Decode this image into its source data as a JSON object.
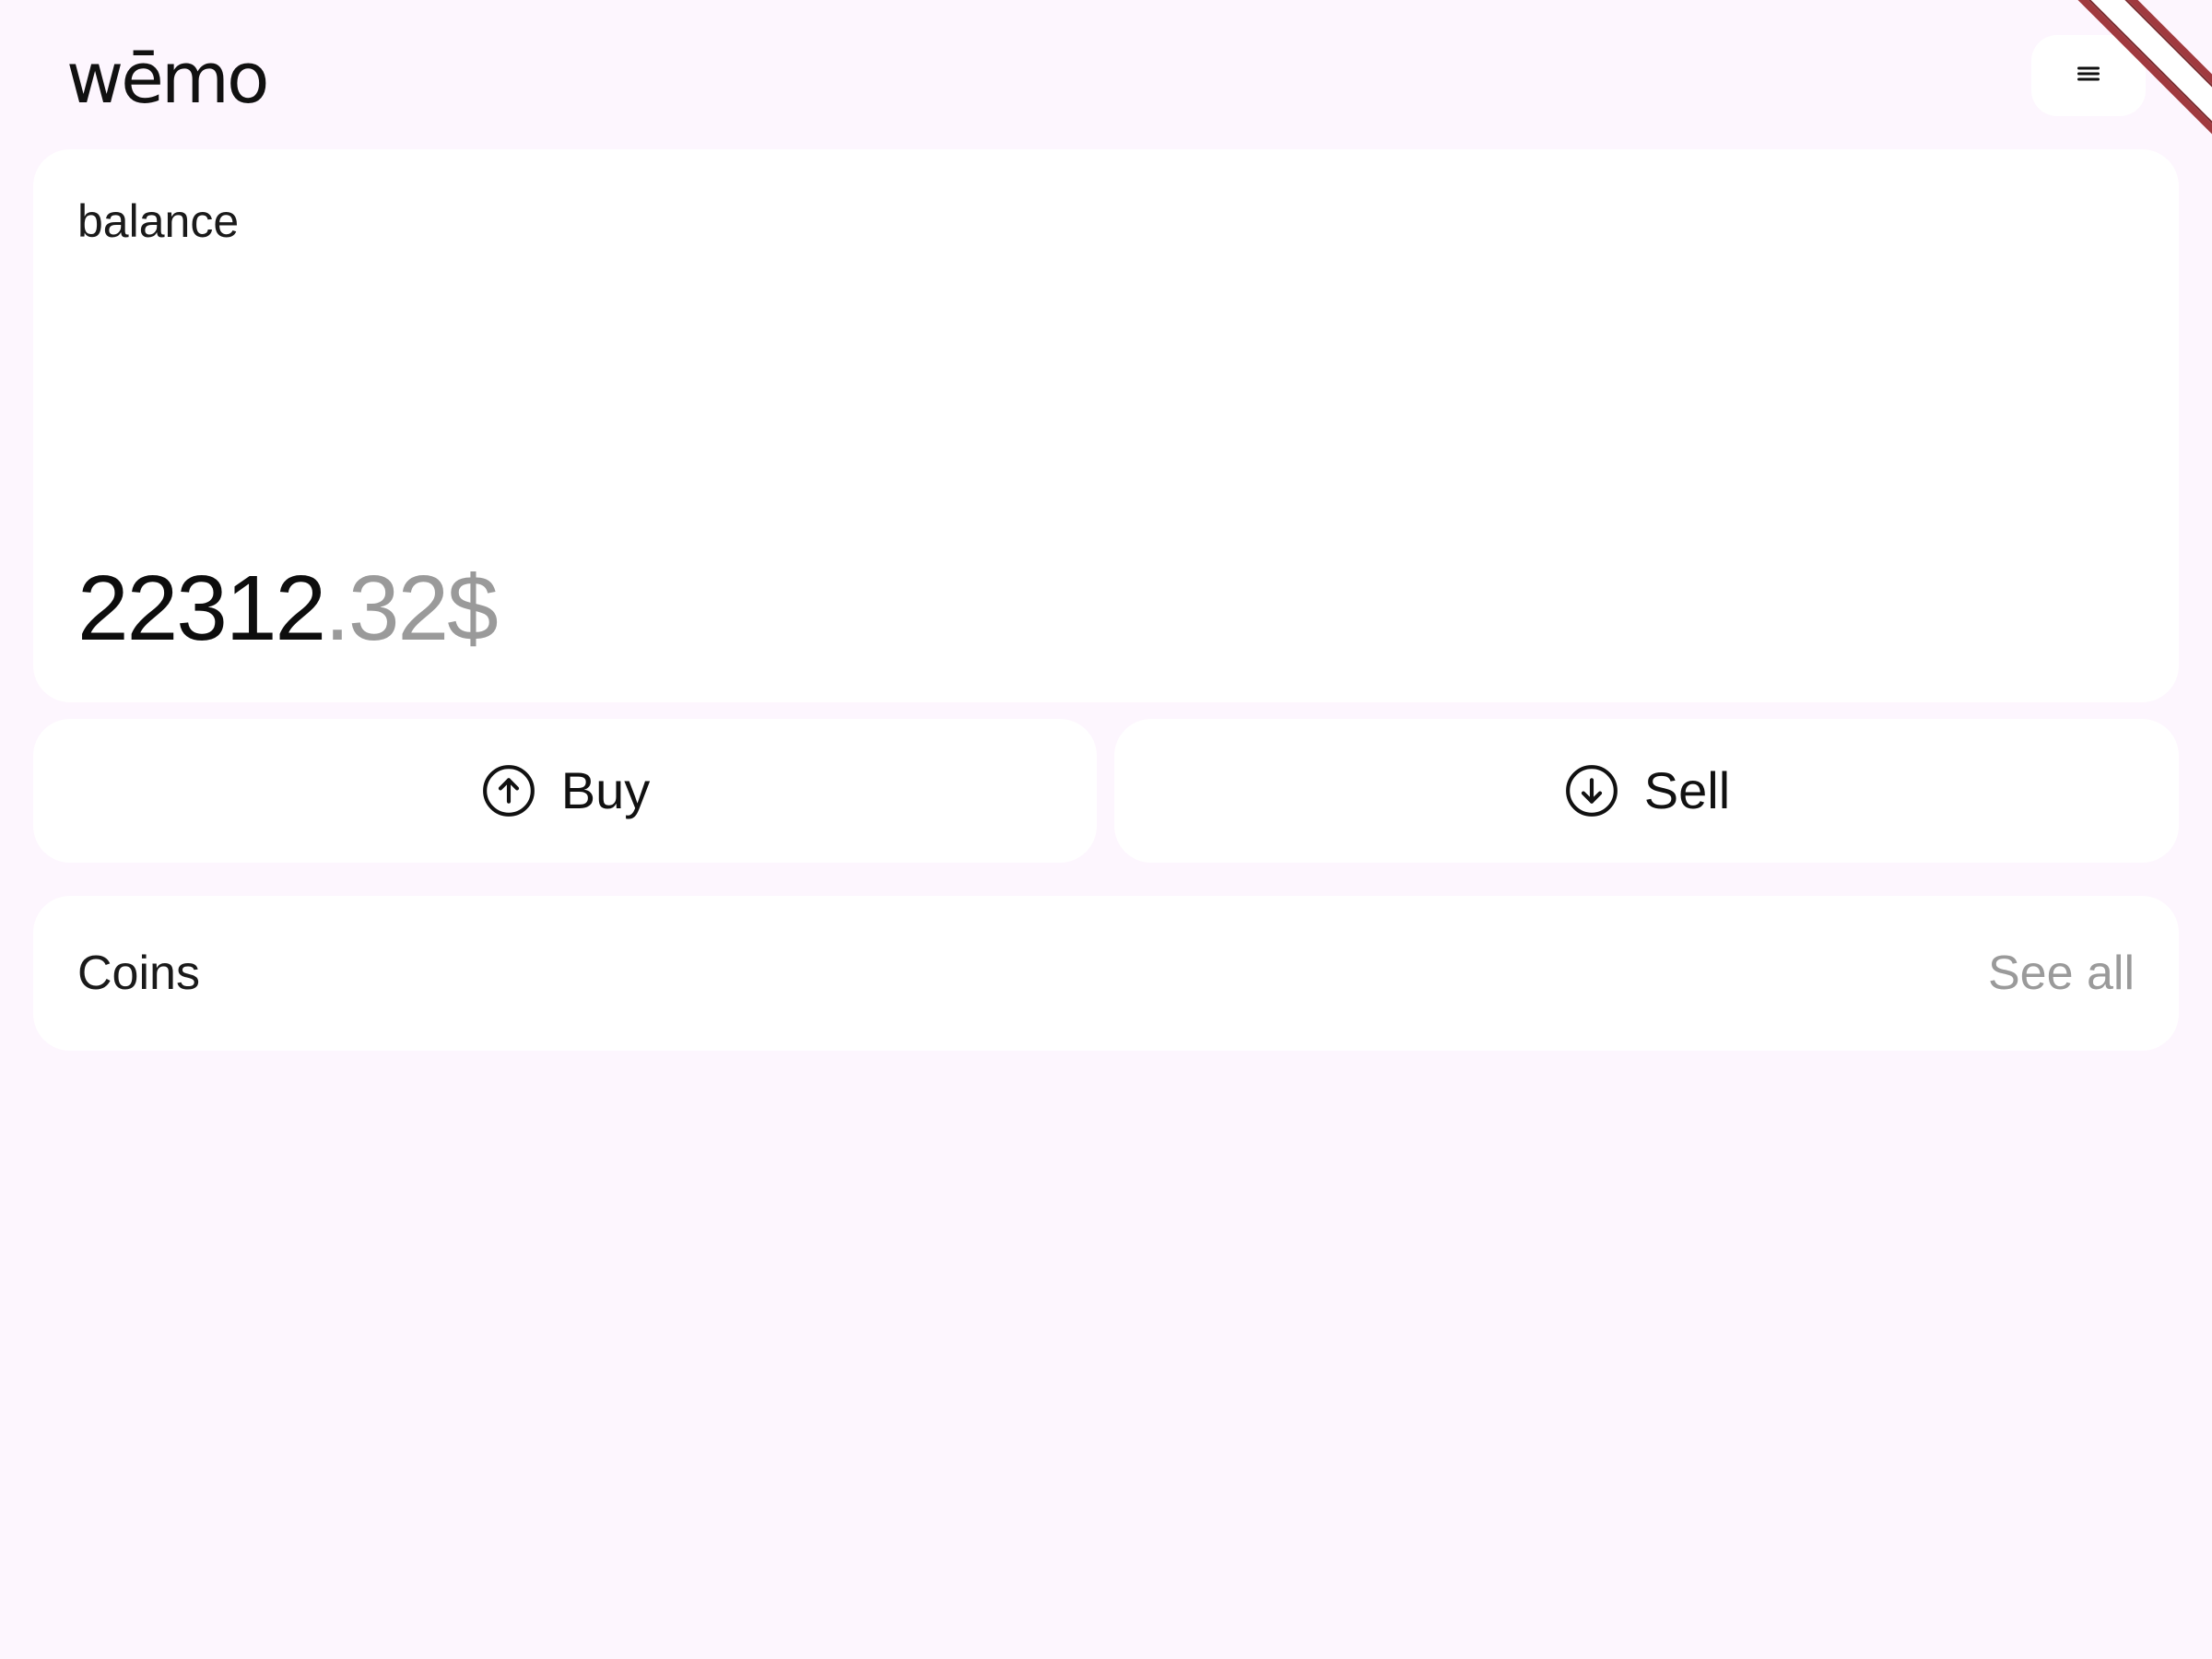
{
  "header": {
    "logo_text": "wēmo",
    "menu_icon": "hamburger-menu-icon"
  },
  "balance": {
    "label": "balance",
    "amount_integer": "22312",
    "amount_decimal": ".32$"
  },
  "actions": {
    "buy_label": "Buy",
    "buy_icon": "arrow-up-circle-icon",
    "sell_label": "Sell",
    "sell_icon": "arrow-down-circle-icon"
  },
  "coins": {
    "title": "Coins",
    "see_all_label": "See all"
  },
  "colors": {
    "background": "#fdf6fe",
    "card": "#ffffff",
    "text_primary": "#111111",
    "text_muted": "#9a9a9a",
    "ribbon": "#a03a3f"
  }
}
